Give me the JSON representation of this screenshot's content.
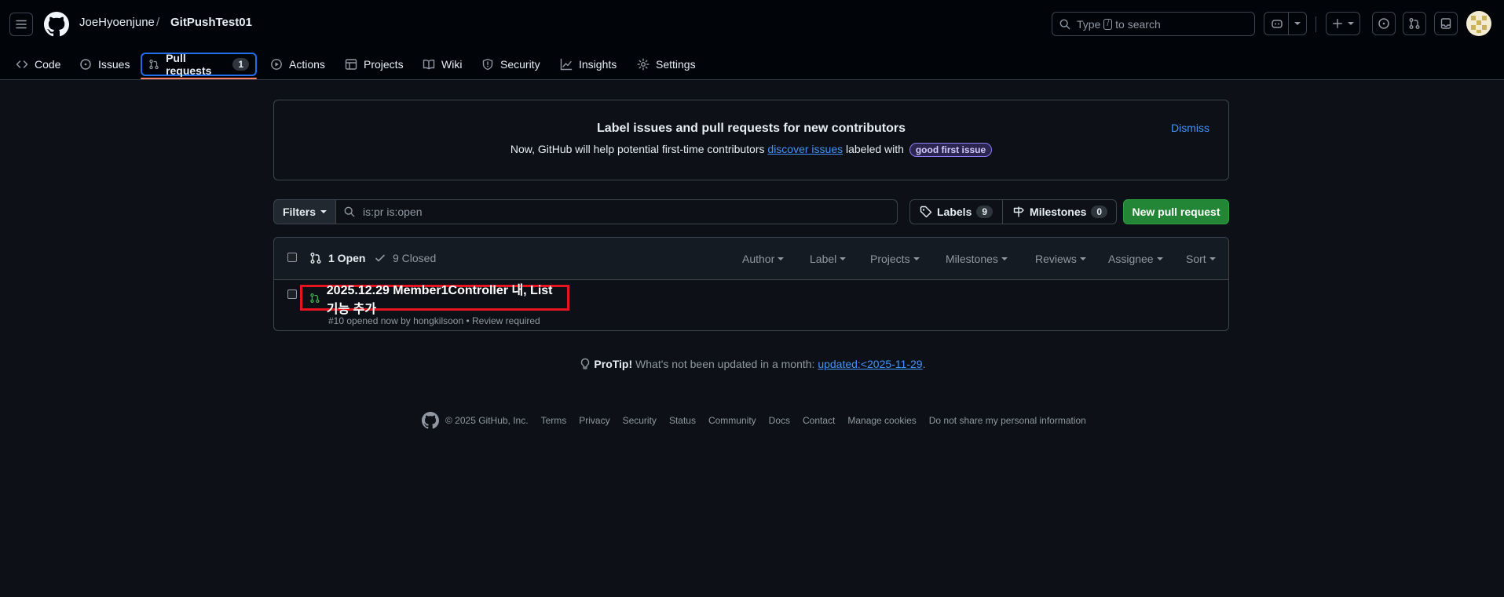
{
  "header": {
    "owner": "JoeHyoenjune",
    "separator": "/",
    "repo": "GitPushTest01",
    "search": {
      "prefix": "Type",
      "key": "/",
      "suffix": "to search"
    }
  },
  "tabs": [
    {
      "label": "Code"
    },
    {
      "label": "Issues"
    },
    {
      "label": "Pull requests",
      "count": "1"
    },
    {
      "label": "Actions"
    },
    {
      "label": "Projects"
    },
    {
      "label": "Wiki"
    },
    {
      "label": "Security"
    },
    {
      "label": "Insights"
    },
    {
      "label": "Settings"
    }
  ],
  "banner": {
    "title": "Label issues and pull requests for new contributors",
    "desc_prefix": "Now, GitHub will help potential first-time contributors",
    "desc_link": "discover issues",
    "desc_mid": "labeled with",
    "pill": "good first issue",
    "dismiss": "Dismiss"
  },
  "filters": {
    "button": "Filters",
    "query": "is:pr is:open",
    "labels": "Labels",
    "labels_count": "9",
    "milestones": "Milestones",
    "milestones_count": "0",
    "new_pr": "New pull request"
  },
  "list": {
    "open": "1 Open",
    "closed": "9 Closed",
    "filters": [
      "Author",
      "Label",
      "Projects",
      "Milestones",
      "Reviews",
      "Assignee",
      "Sort"
    ],
    "items": [
      {
        "title": "2025.12.29 Member1Controller 내, List 기능 추가",
        "meta": "#10 opened now by hongkilsoon • Review required"
      }
    ]
  },
  "protip": {
    "label": "ProTip!",
    "text": "What's not been updated in a month:",
    "link": "updated:<2025-11-29",
    "end": "."
  },
  "footer": {
    "copyright": "© 2025 GitHub, Inc.",
    "links": [
      "Terms",
      "Privacy",
      "Security",
      "Status",
      "Community",
      "Docs",
      "Contact",
      "Manage cookies",
      "Do not share my personal information"
    ]
  },
  "colors": {
    "accent": "#1f6feb",
    "link": "#4493f8",
    "green": "#238636",
    "open_icon": "#3fb950",
    "highlight": "#e5141e",
    "tab_underline": "#f78166"
  }
}
